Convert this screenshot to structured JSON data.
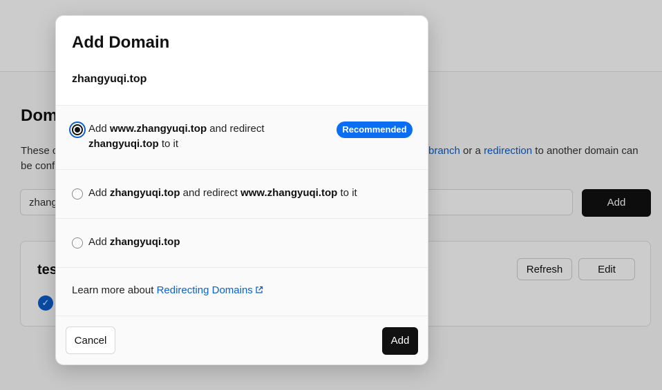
{
  "background": {
    "section_title": "Dom",
    "desc_line1_start": "These c",
    "desc_link_branch": "branch",
    "desc_mid": " or a ",
    "desc_link_redirection": "redirection",
    "desc_end": " to another domain can",
    "desc_line2": "be conf",
    "input_value": "zhang",
    "add_label": "Add",
    "card_title": "tes",
    "refresh_label": "Refresh",
    "edit_label": "Edit"
  },
  "modal": {
    "title": "Add Domain",
    "domain": "zhangyuqi.top",
    "options": [
      {
        "pre": "Add ",
        "b1": "www.zhangyuqi.top",
        "mid": " and redirect",
        "b2": "zhangyuqi.top",
        "post": " to it",
        "selected": true,
        "badge": "Recommended"
      },
      {
        "pre": "Add ",
        "b1": "zhangyuqi.top",
        "mid": " and redirect ",
        "b2": "www.zhangyuqi.top",
        "post": " to it",
        "selected": false
      },
      {
        "pre": "Add ",
        "b1": "zhangyuqi.top",
        "selected": false
      }
    ],
    "learn_text": "Learn more about ",
    "learn_link": "Redirecting Domains",
    "cancel_label": "Cancel",
    "add_label": "Add"
  },
  "colors": {
    "accent": "#0b6ef2",
    "link": "#0b5fd0",
    "primary_button": "#111111"
  },
  "icons": [
    "radio-selected",
    "radio-unselected",
    "external-link-icon",
    "check-icon"
  ]
}
